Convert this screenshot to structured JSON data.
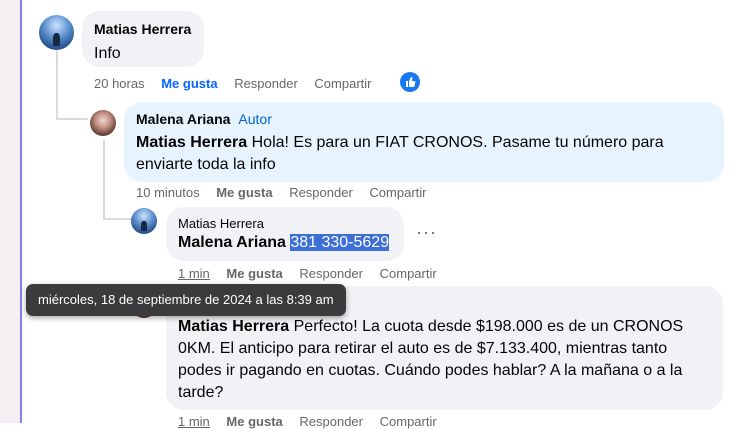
{
  "comments": [
    {
      "name": "Matias Herrera",
      "text": "Info",
      "time": "20 horas",
      "like": "Me gusta",
      "reply": "Responder",
      "share": "Compartir"
    },
    {
      "name": "Malena Ariana",
      "badge": "Autor",
      "mention": "Matias Herrera",
      "text": " Hola! Es para un FIAT CRONOS. Pasame tu número para enviarte toda la info",
      "time": "10 minutos",
      "like": "Me gusta",
      "reply": "Responder",
      "share": "Compartir"
    },
    {
      "name": "Matias Herrera",
      "mention": "Malena Ariana",
      "selected_text": "381 330-5629",
      "more": "···",
      "time": "1 min",
      "like": "Me gusta",
      "reply": "Responder",
      "share": "Compartir"
    },
    {
      "mention": "Matias Herrera",
      "text": " Perfecto! La cuota desde $198.000 es de un CRONOS 0KM. El anticipo para retirar el auto es de $7.133.400, mientras tanto podes ir pagando en cuotas. Cuándo podes hablar? A la mañana o a la tarde?",
      "time": "1 min",
      "like": "Me gusta",
      "reply": "Responder",
      "share": "Compartir"
    }
  ],
  "tooltip": "miércoles, 18 de septiembre de 2024 a las 8:39 am",
  "reaction_icon": "thumbs-up-icon",
  "colors": {
    "accent": "#0866ff",
    "author_bubble": "#e7f3ff",
    "bubble": "#f0f2f5",
    "selection": "#3d6fd8"
  }
}
